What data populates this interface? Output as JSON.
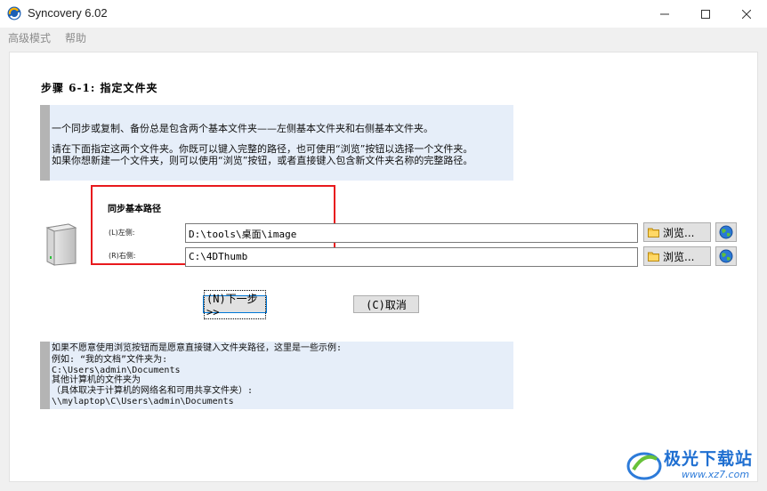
{
  "window": {
    "title": "Syncovery 6.02",
    "controls": {
      "minimize": "—",
      "maximize": "☐",
      "close": "✕"
    }
  },
  "menu": {
    "items": [
      "高级模式",
      "帮助"
    ]
  },
  "step": {
    "title": "步骤 6-1: 指定文件夹"
  },
  "info": {
    "lines": [
      "一个同步或复制、备份总是包含两个基本文件夹——左侧基本文件夹和右侧基本文件夹。",
      "请在下面指定这两个文件夹。你既可以键入完整的路径，也可使用“浏览”按钮以选择一个文件夹。",
      "如果你想新建一个文件夹，则可以使用“浏览”按钮，或者直接键入包含新文件夹名称的完整路径。"
    ]
  },
  "paths": {
    "group_label": "同步基本路径",
    "left": {
      "label": "(L)左侧:",
      "value": "D:\\tools\\桌面\\image"
    },
    "right": {
      "label": "(R)右侧:",
      "value": "C:\\4DThumb"
    },
    "browse_label": "浏览...",
    "highlight_color": "#e8191d"
  },
  "buttons": {
    "next": "(N)下一步 >>",
    "cancel": "(C)取消"
  },
  "examples": {
    "lines": [
      "如果不愿意使用浏览按钮而是愿意直接键入文件夹路径，这里是一些示例:",
      "例如: “我的文档”文件夹为:",
      "C:\\Users\\admin\\Documents",
      "其他计算机的文件夹为",
      "（具体取决于计算机的网络名和可用共享文件夹）:",
      "\\\\mylaptop\\C\\Users\\admin\\Documents"
    ]
  },
  "watermark": {
    "title": "极光下载站",
    "url": "www.xz7.com"
  },
  "icons": [
    "syncovery-app-icon",
    "drive-icon",
    "folder-icon",
    "globe-icon"
  ]
}
